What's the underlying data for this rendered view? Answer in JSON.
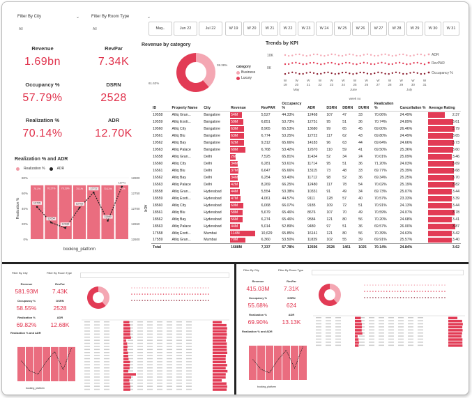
{
  "filters": {
    "city_label": "Filter By City",
    "city_value": "All",
    "room_label": "Filter By Room Type",
    "room_value": "All"
  },
  "month_slicers": [
    "May..",
    "Jun 22",
    "Jul 22"
  ],
  "week_slicers": [
    "W 19",
    "W 20",
    "W 21",
    "W 22",
    "W 23",
    "W 24",
    "W 25",
    "W 26",
    "W 27",
    "W 28",
    "W 29",
    "W 30",
    "W 31"
  ],
  "kpis": {
    "revenue": {
      "label": "Revenue",
      "value": "1.69bn"
    },
    "revpar": {
      "label": "RevPar",
      "value": "7.34K"
    },
    "occupancy": {
      "label": "Occupancy %",
      "value": "57.79%"
    },
    "dsrn": {
      "label": "DSRN",
      "value": "2528"
    },
    "realization": {
      "label": "Realization %",
      "value": "70.14%"
    },
    "adr": {
      "label": "ADR",
      "value": "12.70K"
    }
  },
  "donut": {
    "title": "Revenue by category",
    "legend_title": "category",
    "slices": [
      {
        "name": "Business",
        "pct": 38.38,
        "label": "38.38%",
        "color": "#f4a7b3"
      },
      {
        "name": "Luxury",
        "pct": 61.62,
        "label": "61.62%",
        "color": "#e23b55"
      }
    ]
  },
  "trends": {
    "title": "Trends by KPI",
    "yticks": [
      "10K",
      "0K"
    ],
    "legend": [
      "ADR",
      "RevPAR",
      "Occupancy %"
    ],
    "week_axis": [
      "W",
      "W",
      "W",
      "W",
      "W",
      "W",
      "W",
      "W",
      "W",
      "W",
      "W",
      "W",
      "W"
    ],
    "week_nums": [
      "19",
      "20",
      "21",
      "22",
      "23",
      "24",
      "25",
      "26",
      "27",
      "28",
      "29",
      "30",
      "31"
    ],
    "month_axis": [
      "May",
      "June",
      "July"
    ],
    "axis_title": "week no"
  },
  "table": {
    "headers": [
      "ID",
      "Property Name",
      "City",
      "Revenue",
      "RevPAR",
      "Occupancy %",
      "ADR",
      "DSRN",
      "DBRN",
      "DURN",
      "Realization %",
      "Cancellation %",
      "Average Rating"
    ],
    "rows": [
      [
        "19558",
        "Atliq Gran...",
        "Bangalore",
        "54M",
        "5,527",
        "44.33%",
        "12468",
        "107",
        "47",
        "33",
        "70.06%",
        "24.49%",
        "2.37"
      ],
      [
        "19559",
        "Atliq Exoti...",
        "Bangalore",
        "59M",
        "6,851",
        "53.73%",
        "12751",
        "95",
        "51",
        "36",
        "70.74%",
        "24.89%",
        "3.61"
      ],
      [
        "19560",
        "Atliq City",
        "Bangalore",
        "63M",
        "8,965",
        "65.53%",
        "13680",
        "99",
        "65",
        "45",
        "69.00%",
        "26.46%",
        "3.79"
      ],
      [
        "19561",
        "Atliq Blu",
        "Bangalore",
        "63M",
        "6,774",
        "53.25%",
        "12722",
        "117",
        "62",
        "43",
        "69.80%",
        "24.49%",
        "3.65"
      ],
      [
        "19562",
        "Atliq Bay",
        "Bangalore",
        "62M",
        "9,312",
        "65.66%",
        "14183",
        "96",
        "63",
        "44",
        "69.64%",
        "24.66%",
        "3.73"
      ],
      [
        "19563",
        "Atliq Palace",
        "Bangalore",
        "68M",
        "6,768",
        "53.42%",
        "12670",
        "110",
        "59",
        "41",
        "69.50%",
        "25.36%",
        "3.60"
      ],
      [
        "16558",
        "Atliq Gran...",
        "Delhi",
        "26M",
        "7,525",
        "65.81%",
        "11434",
        "52",
        "34",
        "24",
        "70.01%",
        "25.09%",
        "3.46"
      ],
      [
        "16560",
        "Atliq City",
        "Delhi",
        "34M",
        "6,281",
        "53.61%",
        "11714",
        "95",
        "51",
        "36",
        "71.20%",
        "24.03%",
        "3.69"
      ],
      [
        "16561",
        "Atliq Blu",
        "Delhi",
        "37M",
        "6,647",
        "65.66%",
        "13115",
        "73",
        "48",
        "33",
        "69.77%",
        "25.39%",
        "3.68"
      ],
      [
        "16562",
        "Atliq Bay",
        "Delhi",
        "34M",
        "6,254",
        "53.40%",
        "11712",
        "98",
        "52",
        "36",
        "69.34%",
        "25.25%",
        "3.70"
      ],
      [
        "16563",
        "Atliq Palace",
        "Delhi",
        "42M",
        "8,269",
        "66.25%",
        "12480",
        "117",
        "78",
        "54",
        "70.02%",
        "25.19%",
        "3.82"
      ],
      [
        "18558",
        "Atliq Gran...",
        "Hyderabad",
        "44M",
        "5,554",
        "53.38%",
        "10331",
        "91",
        "49",
        "34",
        "69.73%",
        "25.07%",
        "3.44"
      ],
      [
        "18559",
        "Atliq Exoti...",
        "Hyderabad",
        "47M",
        "4,061",
        "44.57%",
        "9111",
        "128",
        "57",
        "40",
        "70.57%",
        "23.33%",
        "3.39"
      ],
      [
        "18560",
        "Atliq City",
        "Hyderabad",
        "60M",
        "6,068",
        "66.07%",
        "9185",
        "109",
        "72",
        "51",
        "70.91%",
        "24.13%",
        "3.44"
      ],
      [
        "18561",
        "Atliq Blu",
        "Hyderabad",
        "58M",
        "5,679",
        "65.46%",
        "8676",
        "107",
        "70",
        "49",
        "70.59%",
        "24.07%",
        "3.78"
      ],
      [
        "18562",
        "Atliq Bay",
        "Hyderabad",
        "56M",
        "6,274",
        "65.46%",
        "9584",
        "121",
        "80",
        "56",
        "70.20%",
        "24.68%",
        "3.41"
      ],
      [
        "18563",
        "Atliq Palace",
        "Hyderabad",
        "44M",
        "5,014",
        "52.89%",
        "9480",
        "97",
        "51",
        "36",
        "69.57%",
        "26.00%",
        "3.87"
      ],
      [
        "17558",
        "Atliq Exoti...",
        "Mumbai",
        "114M",
        "10,629",
        "65.85%",
        "16141",
        "121",
        "80",
        "56",
        "70.39%",
        "24.63%",
        "3.42"
      ],
      [
        "17559",
        "Atliq Gran...",
        "Mumbai",
        "70M",
        "6,360",
        "53.50%",
        "11839",
        "102",
        "55",
        "39",
        "69.91%",
        "25.57%",
        "3.40"
      ]
    ],
    "total": [
      "Total",
      "",
      "",
      "1688M",
      "7,337",
      "57.78%",
      "12696",
      "2528",
      "1461",
      "1025",
      "70.14%",
      "24.84%",
      "3.62"
    ],
    "revenue_values": [
      54,
      59,
      63,
      63,
      62,
      68,
      26,
      34,
      37,
      34,
      42,
      44,
      47,
      60,
      58,
      56,
      44,
      114,
      70
    ],
    "rating_values": [
      2.37,
      3.61,
      3.79,
      3.65,
      3.73,
      3.6,
      3.46,
      3.69,
      3.68,
      3.7,
      3.82,
      3.44,
      3.39,
      3.44,
      3.78,
      3.41,
      3.87,
      3.42,
      3.4
    ]
  },
  "chart_data": {
    "type": "bar",
    "title": "Realization % and ADR",
    "legend": [
      "Realization %",
      "ADR"
    ],
    "xlabel": "booking_platform",
    "ylabel": "Realization %",
    "y2label": "ADR",
    "yticks": [
      "80%",
      "60%",
      "40%",
      "20%",
      "0%"
    ],
    "y2ticks": [
      "12800",
      "12750",
      "12700",
      "12650",
      "12600"
    ],
    "ylim": [
      0,
      80
    ],
    "y2lim": [
      12600,
      12800
    ],
    "bar_labels": [
      "70.1%",
      "70.27%",
      "70.29%",
      "70.1%",
      "70.15%",
      "70.11%",
      "70.2%"
    ],
    "adr_labels": [
      "12705",
      "12654",
      "12636",
      "12702",
      "12752",
      "12660",
      "12771"
    ],
    "series": [
      {
        "name": "Realization %",
        "values": [
          70.1,
          70.27,
          70.29,
          70.1,
          70.15,
          70.11,
          70.2
        ]
      },
      {
        "name": "ADR",
        "values": [
          12705,
          12654,
          12636,
          12702,
          12752,
          12660,
          12771
        ]
      }
    ],
    "categories": [
      "",
      "",
      "",
      "",
      "",
      "",
      ""
    ]
  },
  "thumb_left": {
    "kpis": [
      {
        "label": "Revenue",
        "value": "581.93M"
      },
      {
        "label": "RevPar",
        "value": "7.43K"
      },
      {
        "label": "Occupancy %",
        "value": "58.55%"
      },
      {
        "label": "DSRN",
        "value": "2528"
      },
      {
        "label": "Realization %",
        "value": "69.82%"
      },
      {
        "label": "ADR",
        "value": "12.68K"
      }
    ],
    "chart_title": "Realization % and ADR",
    "xlabel": "booking_platform"
  },
  "thumb_right": {
    "kpis": [
      {
        "label": "Revenue",
        "value": "415.03M"
      },
      {
        "label": "RevPar",
        "value": "7.31K"
      },
      {
        "label": "Occupancy %",
        "value": "55.68%"
      },
      {
        "label": "DSRN",
        "value": "624"
      },
      {
        "label": "Realization %",
        "value": "69.90%"
      },
      {
        "label": "ADR",
        "value": "13.13K"
      }
    ],
    "chart_title": "Realization % and ADR",
    "xlabel": "booking_platform"
  }
}
